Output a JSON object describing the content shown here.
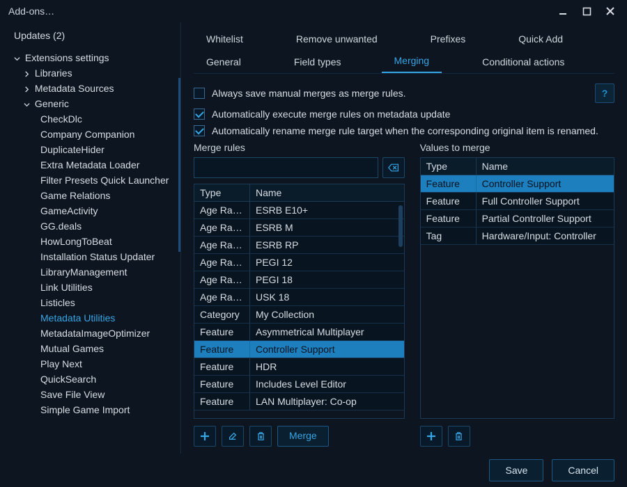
{
  "window": {
    "title": "Add-ons…"
  },
  "sidebar": {
    "updates_label": "Updates (2)",
    "extensions_settings": "Extensions settings",
    "libraries": "Libraries",
    "metadata_sources": "Metadata Sources",
    "generic": "Generic",
    "generic_items": [
      "CheckDlc",
      "Company Companion",
      "DuplicateHider",
      "Extra Metadata Loader",
      "Filter Presets Quick Launcher",
      "Game Relations",
      "GameActivity",
      "GG.deals",
      "HowLongToBeat",
      "Installation Status Updater",
      "LibraryManagement",
      "Link Utilities",
      "Listicles",
      "Metadata Utilities",
      "MetadataImageOptimizer",
      "Mutual Games",
      "Play Next",
      "QuickSearch",
      "Save File View",
      "Simple Game Import"
    ],
    "selected_generic_item": "Metadata Utilities"
  },
  "tabs": {
    "row1": [
      "Whitelist",
      "Remove unwanted",
      "Prefixes",
      "Quick Add"
    ],
    "row2": [
      "General",
      "Field types",
      "Merging",
      "Conditional actions"
    ],
    "active_row2": "Merging"
  },
  "options": {
    "opt1": {
      "label": "Always save manual merges as merge rules.",
      "checked": false
    },
    "opt2": {
      "label": "Automatically execute merge rules on metadata update",
      "checked": true
    },
    "opt3": {
      "label": "Automatically rename merge rule target when the corresponding original item is renamed.",
      "checked": true
    }
  },
  "merge_rules": {
    "title": "Merge rules",
    "search_placeholder": "",
    "columns": {
      "type": "Type",
      "name": "Name"
    },
    "rows": [
      {
        "type": "Age Rating",
        "name": "ESRB E10+"
      },
      {
        "type": "Age Rating",
        "name": "ESRB M"
      },
      {
        "type": "Age Rating",
        "name": "ESRB RP"
      },
      {
        "type": "Age Rating",
        "name": "PEGI 12"
      },
      {
        "type": "Age Rating",
        "name": "PEGI 18"
      },
      {
        "type": "Age Rating",
        "name": "USK 18"
      },
      {
        "type": "Category",
        "name": "My Collection"
      },
      {
        "type": "Feature",
        "name": "Asymmetrical Multiplayer"
      },
      {
        "type": "Feature",
        "name": "Controller Support"
      },
      {
        "type": "Feature",
        "name": "HDR"
      },
      {
        "type": "Feature",
        "name": "Includes Level Editor"
      },
      {
        "type": "Feature",
        "name": "LAN Multiplayer: Co-op"
      }
    ],
    "selected_index": 8,
    "merge_button": "Merge"
  },
  "values_to_merge": {
    "title": "Values to merge",
    "columns": {
      "type": "Type",
      "name": "Name"
    },
    "rows": [
      {
        "type": "Feature",
        "name": "Controller Support"
      },
      {
        "type": "Feature",
        "name": "Full Controller Support"
      },
      {
        "type": "Feature",
        "name": "Partial Controller Support"
      },
      {
        "type": "Tag",
        "name": "Hardware/Input: Controller"
      }
    ],
    "selected_index": 0
  },
  "footer": {
    "save": "Save",
    "cancel": "Cancel"
  }
}
